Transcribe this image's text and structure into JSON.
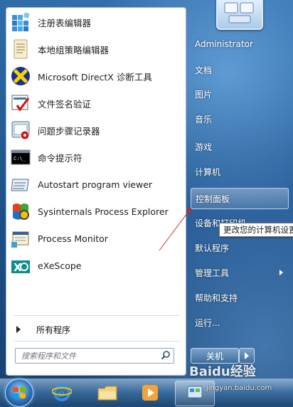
{
  "programs": [
    {
      "label": "注册表编辑器",
      "icon": "registry-editor-icon"
    },
    {
      "label": "本地组策略编辑器",
      "icon": "group-policy-icon"
    },
    {
      "label": "Microsoft DirectX 诊断工具",
      "icon": "directx-icon"
    },
    {
      "label": "文件签名验证",
      "icon": "file-signature-icon"
    },
    {
      "label": "问题步骤记录器",
      "icon": "steps-recorder-icon"
    },
    {
      "label": "命令提示符",
      "icon": "command-prompt-icon"
    },
    {
      "label": "Autostart program viewer",
      "icon": "autostart-icon"
    },
    {
      "label": "Sysinternals Process Explorer",
      "icon": "process-explorer-icon"
    },
    {
      "label": "Process Monitor",
      "icon": "process-monitor-icon"
    },
    {
      "label": "eXeScope",
      "icon": "exescope-icon"
    }
  ],
  "all_programs": "所有程序",
  "search": {
    "placeholder": "搜索程序和文件"
  },
  "right_items": [
    {
      "label": "Administrator"
    },
    {
      "label": "文档"
    },
    {
      "label": "图片"
    },
    {
      "label": "音乐"
    },
    {
      "label": "游戏"
    },
    {
      "label": "计算机"
    },
    {
      "label": "控制面板"
    },
    {
      "label": "设备和打印机"
    },
    {
      "label": "默认程序"
    },
    {
      "label": "管理工具"
    },
    {
      "label": "帮助和支持"
    },
    {
      "label": "运行..."
    }
  ],
  "tooltip": "更改您的计算机设置",
  "shutdown": "关机",
  "watermark": {
    "brand": "Baidu经验",
    "url": "jingyan.baidu.com"
  },
  "colors": {
    "highlight": "#ffffff",
    "accent": "#2b6fb8"
  }
}
